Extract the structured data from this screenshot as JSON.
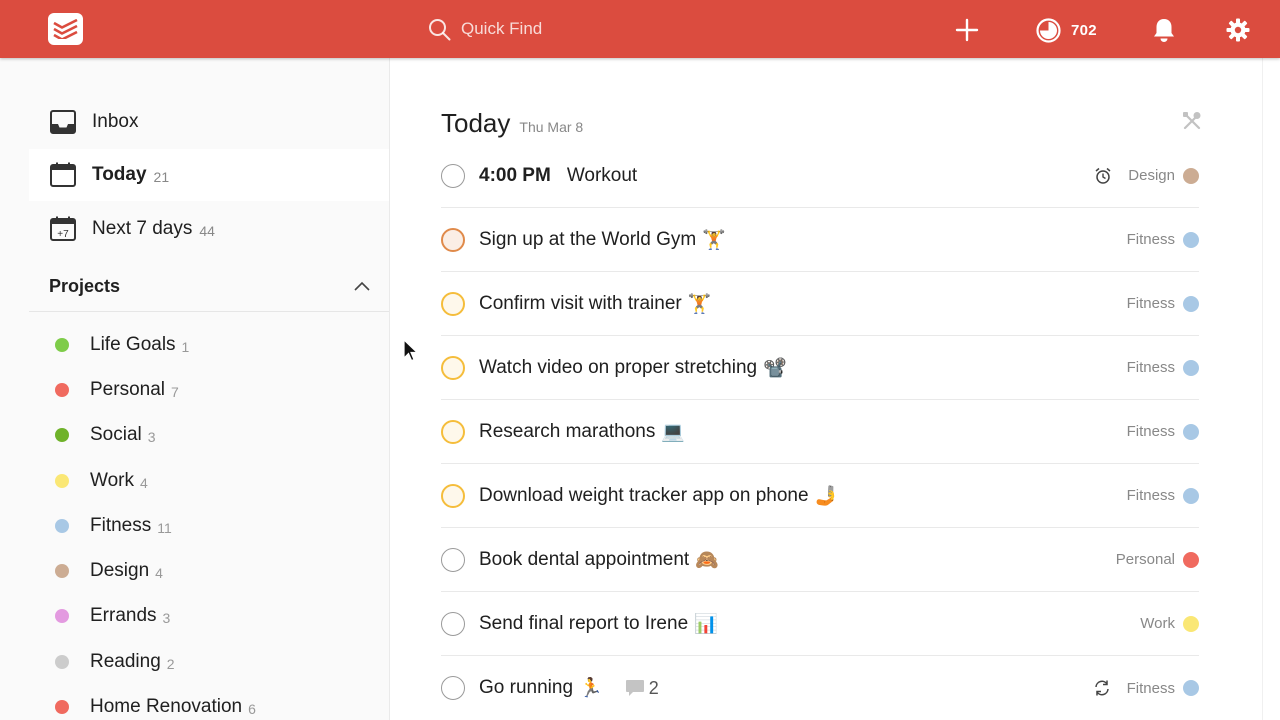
{
  "topbar": {
    "search_placeholder": "Quick Find",
    "karma": "702"
  },
  "sidebar": {
    "nav": [
      {
        "label": "Inbox",
        "count": ""
      },
      {
        "label": "Today",
        "count": "21"
      },
      {
        "label": "Next 7 days",
        "count": "44",
        "icon_text": "+7"
      }
    ],
    "projects_title": "Projects",
    "projects": [
      {
        "label": "Life Goals",
        "count": "1",
        "color": "#7ecc49"
      },
      {
        "label": "Personal",
        "count": "7",
        "color": "#f06a5f"
      },
      {
        "label": "Social",
        "count": "3",
        "color": "#6fb22a"
      },
      {
        "label": "Work",
        "count": "4",
        "color": "#fae775"
      },
      {
        "label": "Fitness",
        "count": "11",
        "color": "#a8c8e5"
      },
      {
        "label": "Design",
        "count": "4",
        "color": "#ccac93"
      },
      {
        "label": "Errands",
        "count": "3",
        "color": "#e39ae0"
      },
      {
        "label": "Reading",
        "count": "2",
        "color": "#cccccc"
      },
      {
        "label": "Home Renovation",
        "count": "6",
        "color": "#f06a5f"
      }
    ]
  },
  "main": {
    "title": "Today",
    "date": "Thu Mar 8",
    "tasks": [
      {
        "time": "4:00 PM",
        "text": "Workout",
        "emoji": "",
        "project": "Design",
        "color": "#ccac93"
      },
      {
        "text": "Sign up at the World Gym",
        "emoji": "🏋️",
        "project": "Fitness",
        "color": "#a8c8e5"
      },
      {
        "text": "Confirm visit with trainer",
        "emoji": "🏋️",
        "project": "Fitness",
        "color": "#a8c8e5"
      },
      {
        "text": "Watch video on proper stretching",
        "emoji": "📽️",
        "project": "Fitness",
        "color": "#a8c8e5"
      },
      {
        "text": "Research marathons",
        "emoji": "💻",
        "project": "Fitness",
        "color": "#a8c8e5"
      },
      {
        "text": "Download weight tracker app on phone",
        "emoji": "🤳",
        "project": "Fitness",
        "color": "#a8c8e5"
      },
      {
        "text": "Book dental appointment",
        "emoji": "🙈",
        "project": "Personal",
        "color": "#f06a5f"
      },
      {
        "text": "Send final report to Irene",
        "emoji": "📊",
        "project": "Work",
        "color": "#fae775"
      },
      {
        "text": "Go running",
        "emoji": "🏃",
        "comment_count": "2",
        "project": "Fitness",
        "color": "#a8c8e5"
      }
    ]
  },
  "icons": [
    "todoist-logo-icon",
    "search-icon",
    "plus-icon",
    "karma-icon",
    "bell-icon",
    "gear-icon",
    "inbox-icon",
    "calendar-today-icon",
    "calendar-week-icon",
    "chevron-up-icon",
    "tools-icon",
    "alarm-icon",
    "comment-icon",
    "recurring-icon",
    "mouse-cursor-icon"
  ],
  "colors": {
    "brand": "#db4c3f",
    "priority1": "#e08a4a",
    "priority3": "#f5bd3b"
  }
}
